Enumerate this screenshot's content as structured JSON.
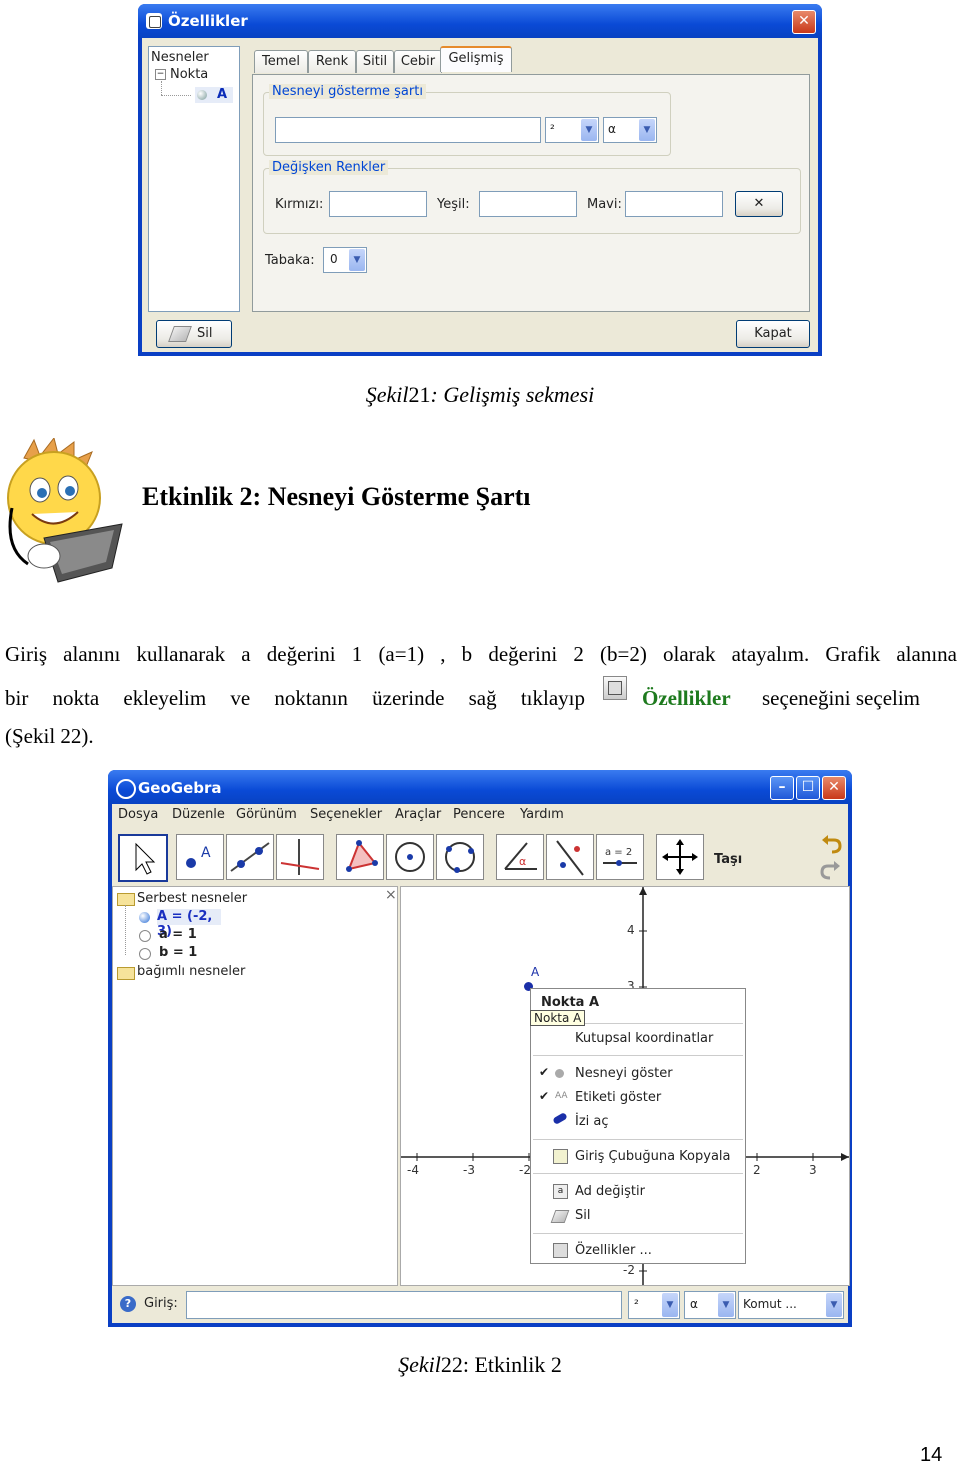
{
  "figure1": {
    "window_title": "Özellikler",
    "close_icon": "close-icon",
    "tree": {
      "root": "Nesneler",
      "group": "Nokta",
      "item": "A"
    },
    "tabs": [
      "Temel",
      "Renk",
      "Sitil",
      "Cebir",
      "Gelişmiş"
    ],
    "active_tab": "Gelişmiş",
    "condition_group": "Nesneyi gösterme şartı",
    "combo_left": "²",
    "combo_right": "α",
    "colors_group": "Değişken Renkler",
    "red_label": "Kırmızı:",
    "green_label": "Yeşil:",
    "blue_label": "Mavi:",
    "clear_button": "✕",
    "layer_label": "Tabaka:",
    "layer_value": "0",
    "delete_button": "Sil",
    "close_button": "Kapat"
  },
  "caption1": {
    "prefix": "Şekil",
    "number": "21",
    "text": ": Gelişmiş sekmesi"
  },
  "activity": {
    "title": "Etkinlik 2: Nesneyi Gösterme Şartı"
  },
  "paragraph": {
    "line1": "Giriş alanını kullanarak a değerini 1 (a=1) , b değerini 2 (b=2) olarak atayalım. Grafik alanına",
    "line2_a": "bir nokta ekleyelim ve noktanın üzerinde sağ tıklayıp",
    "line2_b": "Özellikler",
    "line2_c": "seçeneğini seçelim",
    "line3": "(Şekil 22).",
    "highlight_color": "#1e7a1e"
  },
  "figure2": {
    "window_title": "GeoGebra",
    "menu": [
      "Dosya",
      "Düzenle",
      "Görünüm",
      "Seçenekler",
      "Araçlar",
      "Pencere",
      "Yardım"
    ],
    "toolbar_label": "Taşı",
    "algebra": {
      "free_objects": "Serbest nesneler",
      "items": [
        "A = (-2, 3)",
        "a = 1",
        "b = 1"
      ],
      "dependent_objects": "bağımlı nesneler"
    },
    "point_label": "A",
    "context_menu": {
      "title": "Nokta A",
      "tooltip": "Nokta A",
      "items": [
        "Kutupsal koordinatlar",
        "Nesneyi göster",
        "Etiketi göster",
        "İzi aç",
        "Giriş Çubuğuna Kopyala",
        "Ad değiştir",
        "Sil",
        "Özellikler ..."
      ]
    },
    "axis_x_ticks": [
      "-4",
      "-3",
      "-2",
      "2",
      "3"
    ],
    "axis_y_ticks": [
      "4",
      "3",
      "-2"
    ],
    "input_label": "Giriş:",
    "combo_1": "²",
    "combo_2": "α",
    "combo_3": "Komut ..."
  },
  "caption2": {
    "prefix": "Şekil",
    "number": "22",
    "text": ": Etkinlik 2"
  },
  "page_number": "14",
  "colors": {
    "titlebar": "#0a4ad6",
    "dialog_bg": "#ece9d8",
    "accent_orange": "#e68b2c"
  }
}
